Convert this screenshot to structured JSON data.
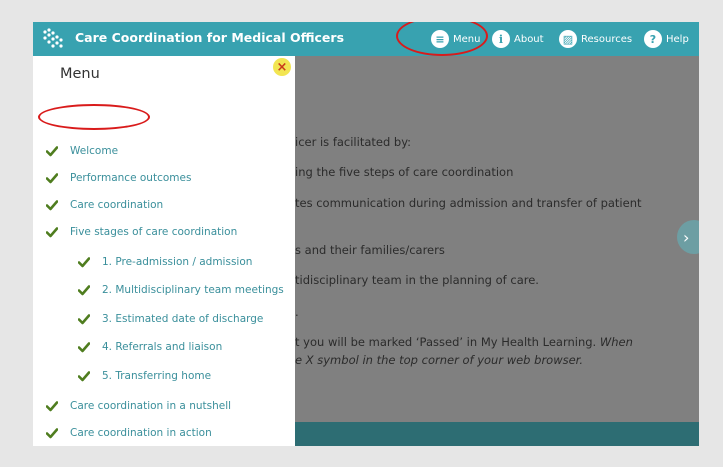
{
  "app": {
    "title": "Care Coordination for Medical Officers"
  },
  "nav": [
    {
      "icon": "menu-icon",
      "glyph": "≡",
      "label": "Menu"
    },
    {
      "icon": "info-icon",
      "glyph": "i",
      "label": "About"
    },
    {
      "icon": "resources-icon",
      "glyph": "▨",
      "label": "Resources"
    },
    {
      "icon": "help-icon",
      "glyph": "?",
      "label": "Help"
    }
  ],
  "menu": {
    "title": "Menu",
    "close_glyph": "×",
    "items": [
      {
        "label": "Welcome",
        "level": 0,
        "completed": true
      },
      {
        "label": "Performance outcomes",
        "level": 0,
        "completed": true
      },
      {
        "label": "Care coordination",
        "level": 0,
        "completed": true
      },
      {
        "label": "Five stages of care coordination",
        "level": 0,
        "completed": true
      },
      {
        "label": "1.  Pre-admission / admission",
        "level": 1,
        "completed": true
      },
      {
        "label": "2.  Multidisciplinary team meetings",
        "level": 1,
        "completed": true
      },
      {
        "label": "3.  Estimated date of discharge",
        "level": 1,
        "completed": true
      },
      {
        "label": "4.  Referrals and liaison",
        "level": 1,
        "completed": true
      },
      {
        "label": "5.  Transferring home",
        "level": 1,
        "completed": true
      },
      {
        "label": "Care coordination in a nutshell",
        "level": 0,
        "completed": true
      },
      {
        "label": "Care coordination in action",
        "level": 0,
        "completed": true
      }
    ]
  },
  "content": {
    "lines": [
      "icer is facilitated by:",
      "ing the five steps of care coordination",
      "tes communication during admission and transfer of patient",
      "s and their families/carers",
      "tidisciplinary team in the planning of care.",
      "."
    ],
    "passed_text": "t you will be marked ‘Passed’ in My Health Learning. ",
    "passed_italic": "When",
    "close_note": "e X symbol in the top corner of your web browser."
  },
  "colors": {
    "accent": "#38a2b0",
    "check": "#4f7d1f",
    "highlight": "#d91b1b",
    "close_bg": "#f2e552"
  }
}
